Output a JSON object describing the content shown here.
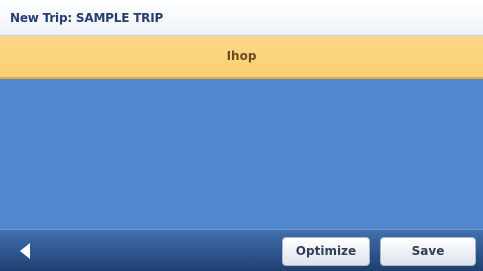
{
  "window": {
    "title": "New Trip: SAMPLE TRIP"
  },
  "trip_list": {
    "items": [
      {
        "label": "Ihop",
        "selected": true
      }
    ]
  },
  "toolbar": {
    "back_icon": "back-arrow-icon",
    "optimize_label": "Optimize",
    "save_label": "Save"
  },
  "colors": {
    "title_text": "#243e74",
    "list_background": "#5087cd",
    "selected_row": "#f9cf72",
    "toolbar_background": "#2f568f"
  }
}
